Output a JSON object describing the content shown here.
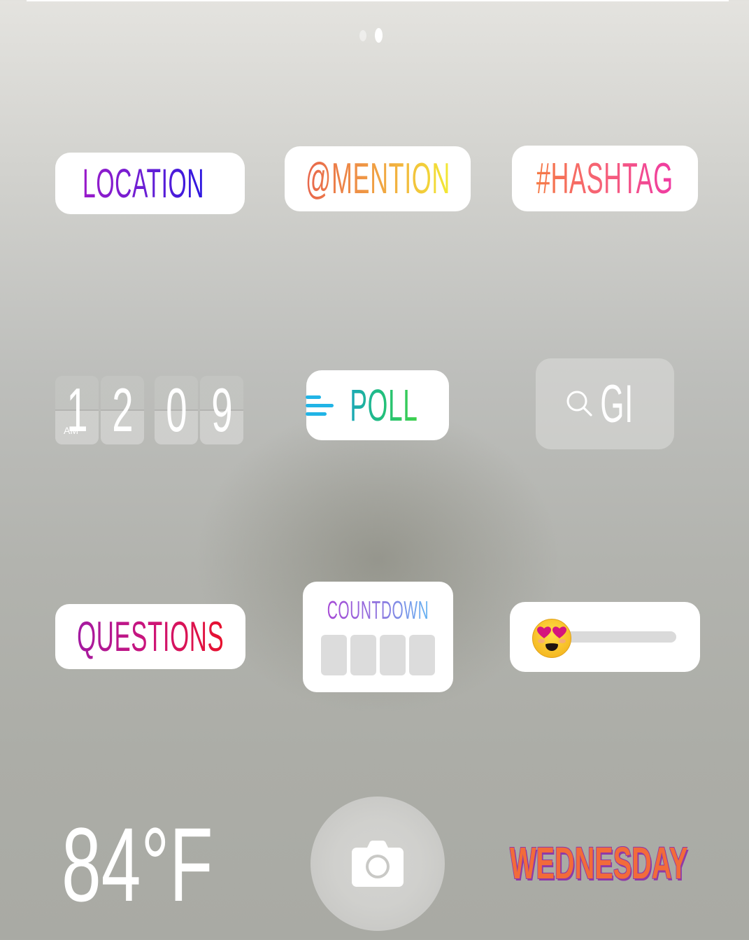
{
  "pager": {
    "page_count": 2,
    "active_page": 2
  },
  "stickers": {
    "location": {
      "label": "LOCATION",
      "icon": "map-pin-icon",
      "gradient": [
        "#9a1ac9",
        "#2c18e0"
      ]
    },
    "mention": {
      "label": "@MENTION",
      "gradient": [
        "#e8664c",
        "#f2ea34"
      ]
    },
    "hashtag": {
      "label": "#HASHTAG",
      "gradient": [
        "#f57a45",
        "#ef3aa3"
      ]
    },
    "clock": {
      "digits": [
        "1",
        "2",
        "0",
        "9"
      ],
      "period": "AM"
    },
    "poll": {
      "label": "POLL",
      "icon": "poll-bars-icon",
      "gradient": [
        "#1aa8b8",
        "#3fd14a"
      ]
    },
    "gif": {
      "label": "GI",
      "icon": "search-icon"
    },
    "questions": {
      "label": "QUESTIONS",
      "gradient": [
        "#a31aa2",
        "#e8112c"
      ]
    },
    "countdown": {
      "label": "COUNTDOWN",
      "gradient": [
        "#a64ad6",
        "#67b4f2"
      ],
      "box_count": 4
    },
    "emoji_slider": {
      "emoji": "heart-eyes-emoji",
      "value": 0
    },
    "temperature": {
      "label": "84°F"
    },
    "weekday": {
      "label": "WEDNESDAY",
      "fill": "#f26b3a",
      "shadow": "#8f3aa6"
    }
  },
  "capture_button": {
    "icon": "camera-icon"
  }
}
